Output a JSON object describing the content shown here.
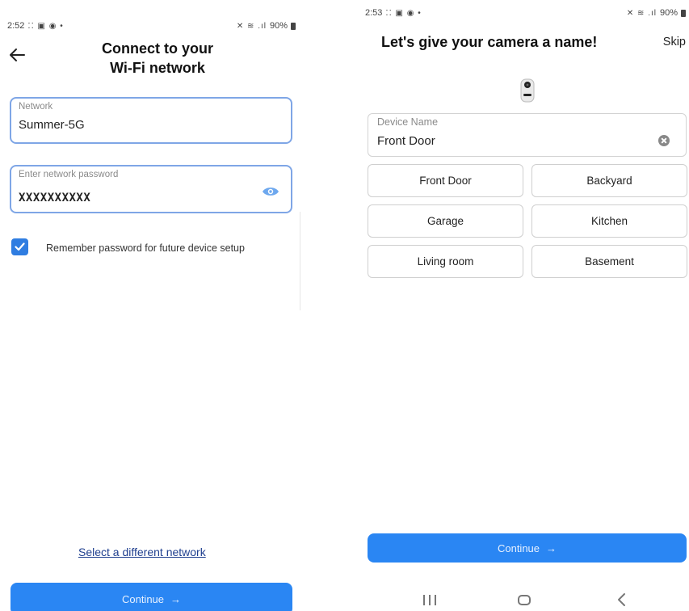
{
  "left_screen": {
    "status": {
      "time": "2:52",
      "indicators": "⁚⁚ ▣ ◉ •",
      "right": "✕ ≋ .ıl",
      "battery": "90%"
    },
    "back_icon": "arrow-left-icon",
    "title_line1": "Connect to your",
    "title_line2": "Wi-Fi network",
    "network_field": {
      "label": "Network",
      "value": "Summer-5G"
    },
    "password_field": {
      "label": "Enter network password",
      "value": "XXXXXXXXXX",
      "icon": "eye-icon"
    },
    "remember": {
      "checked": true,
      "label": "Remember password for future device setup"
    },
    "select_network_link": "Select a different network",
    "continue_button": {
      "label": "Continue",
      "arrow": "→"
    }
  },
  "right_screen": {
    "status": {
      "time": "2:53",
      "indicators": "⁚⁚ ▣ ◉ •",
      "right": "✕ ≋ .ıl",
      "battery": "90%"
    },
    "title": "Let's give your camera a name!",
    "skip": "Skip",
    "device_field": {
      "label": "Device Name",
      "value": "Front Door"
    },
    "suggestions": [
      "Front Door",
      "Backyard",
      "Garage",
      "Kitchen",
      "Living room",
      "Basement"
    ],
    "continue_button": {
      "label": "Continue",
      "arrow": "→"
    }
  },
  "colors": {
    "primary": "#2a86f3",
    "field_border_focus": "#7fa6e6",
    "link": "#1f3f8f",
    "checkbox": "#2f7de1"
  }
}
